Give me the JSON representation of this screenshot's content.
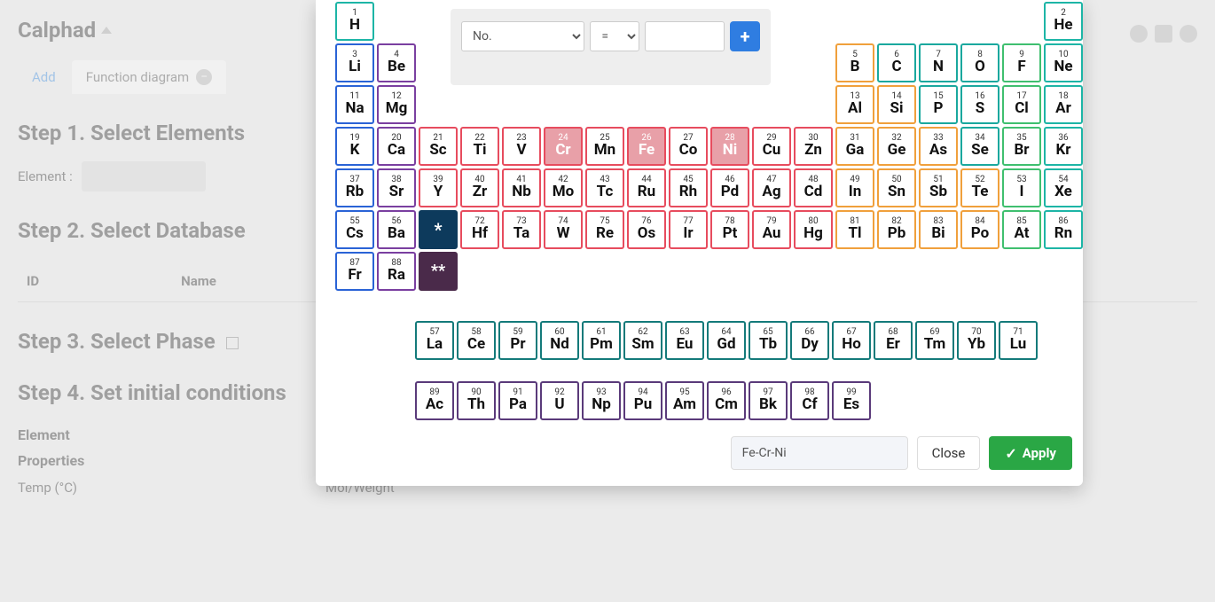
{
  "page": {
    "title": "Calphad",
    "tabs": {
      "add": "Add",
      "func": "Function diagram"
    },
    "step1": "Step 1. Select Elements",
    "element_label": "Element :",
    "step2": "Step 2. Select Database",
    "tbl_id": "ID",
    "tbl_name": "Name",
    "step3": "Step 3. Select Phase",
    "step4": "Step 4. Set initial conditions",
    "element_h": "Element",
    "properties_h": "Properties",
    "temp": "Temp (°C)",
    "molw": "Mol/Weight"
  },
  "filter": {
    "prop": "No.",
    "op": "=",
    "plus": "+"
  },
  "footer": {
    "value": "Fe-Cr-Ni",
    "close": "Close",
    "apply": "Apply"
  },
  "selected": [
    "Cr",
    "Fe",
    "Ni"
  ],
  "elements": [
    {
      "n": 1,
      "s": "H",
      "r": 0,
      "c": 0,
      "k": "c-teal"
    },
    {
      "n": 2,
      "s": "He",
      "r": 0,
      "c": 17,
      "k": "c-teal"
    },
    {
      "n": 3,
      "s": "Li",
      "r": 1,
      "c": 0,
      "k": "c-blue"
    },
    {
      "n": 4,
      "s": "Be",
      "r": 1,
      "c": 1,
      "k": "c-purple"
    },
    {
      "n": 5,
      "s": "B",
      "r": 1,
      "c": 12,
      "k": "c-orange"
    },
    {
      "n": 6,
      "s": "C",
      "r": 1,
      "c": 13,
      "k": "c-teal2"
    },
    {
      "n": 7,
      "s": "N",
      "r": 1,
      "c": 14,
      "k": "c-teal2"
    },
    {
      "n": 8,
      "s": "O",
      "r": 1,
      "c": 15,
      "k": "c-teal2"
    },
    {
      "n": 9,
      "s": "F",
      "r": 1,
      "c": 16,
      "k": "c-green"
    },
    {
      "n": 10,
      "s": "Ne",
      "r": 1,
      "c": 17,
      "k": "c-teal"
    },
    {
      "n": 11,
      "s": "Na",
      "r": 2,
      "c": 0,
      "k": "c-blue"
    },
    {
      "n": 12,
      "s": "Mg",
      "r": 2,
      "c": 1,
      "k": "c-purple"
    },
    {
      "n": 13,
      "s": "Al",
      "r": 2,
      "c": 12,
      "k": "c-orange"
    },
    {
      "n": 14,
      "s": "Si",
      "r": 2,
      "c": 13,
      "k": "c-orange"
    },
    {
      "n": 15,
      "s": "P",
      "r": 2,
      "c": 14,
      "k": "c-teal2"
    },
    {
      "n": 16,
      "s": "S",
      "r": 2,
      "c": 15,
      "k": "c-teal2"
    },
    {
      "n": 17,
      "s": "Cl",
      "r": 2,
      "c": 16,
      "k": "c-green"
    },
    {
      "n": 18,
      "s": "Ar",
      "r": 2,
      "c": 17,
      "k": "c-teal"
    },
    {
      "n": 19,
      "s": "K",
      "r": 3,
      "c": 0,
      "k": "c-blue"
    },
    {
      "n": 20,
      "s": "Ca",
      "r": 3,
      "c": 1,
      "k": "c-purple"
    },
    {
      "n": 21,
      "s": "Sc",
      "r": 3,
      "c": 2,
      "k": "c-red"
    },
    {
      "n": 22,
      "s": "Ti",
      "r": 3,
      "c": 3,
      "k": "c-red"
    },
    {
      "n": 23,
      "s": "V",
      "r": 3,
      "c": 4,
      "k": "c-red"
    },
    {
      "n": 24,
      "s": "Cr",
      "r": 3,
      "c": 5,
      "k": "c-red"
    },
    {
      "n": 25,
      "s": "Mn",
      "r": 3,
      "c": 6,
      "k": "c-red"
    },
    {
      "n": 26,
      "s": "Fe",
      "r": 3,
      "c": 7,
      "k": "c-red"
    },
    {
      "n": 27,
      "s": "Co",
      "r": 3,
      "c": 8,
      "k": "c-red"
    },
    {
      "n": 28,
      "s": "Ni",
      "r": 3,
      "c": 9,
      "k": "c-red"
    },
    {
      "n": 29,
      "s": "Cu",
      "r": 3,
      "c": 10,
      "k": "c-red"
    },
    {
      "n": 30,
      "s": "Zn",
      "r": 3,
      "c": 11,
      "k": "c-red"
    },
    {
      "n": 31,
      "s": "Ga",
      "r": 3,
      "c": 12,
      "k": "c-orange"
    },
    {
      "n": 32,
      "s": "Ge",
      "r": 3,
      "c": 13,
      "k": "c-orange"
    },
    {
      "n": 33,
      "s": "As",
      "r": 3,
      "c": 14,
      "k": "c-orange"
    },
    {
      "n": 34,
      "s": "Se",
      "r": 3,
      "c": 15,
      "k": "c-teal2"
    },
    {
      "n": 35,
      "s": "Br",
      "r": 3,
      "c": 16,
      "k": "c-green"
    },
    {
      "n": 36,
      "s": "Kr",
      "r": 3,
      "c": 17,
      "k": "c-teal"
    },
    {
      "n": 37,
      "s": "Rb",
      "r": 4,
      "c": 0,
      "k": "c-blue"
    },
    {
      "n": 38,
      "s": "Sr",
      "r": 4,
      "c": 1,
      "k": "c-purple"
    },
    {
      "n": 39,
      "s": "Y",
      "r": 4,
      "c": 2,
      "k": "c-red"
    },
    {
      "n": 40,
      "s": "Zr",
      "r": 4,
      "c": 3,
      "k": "c-red"
    },
    {
      "n": 41,
      "s": "Nb",
      "r": 4,
      "c": 4,
      "k": "c-red"
    },
    {
      "n": 42,
      "s": "Mo",
      "r": 4,
      "c": 5,
      "k": "c-red"
    },
    {
      "n": 43,
      "s": "Tc",
      "r": 4,
      "c": 6,
      "k": "c-red"
    },
    {
      "n": 44,
      "s": "Ru",
      "r": 4,
      "c": 7,
      "k": "c-red"
    },
    {
      "n": 45,
      "s": "Rh",
      "r": 4,
      "c": 8,
      "k": "c-red"
    },
    {
      "n": 46,
      "s": "Pd",
      "r": 4,
      "c": 9,
      "k": "c-red"
    },
    {
      "n": 47,
      "s": "Ag",
      "r": 4,
      "c": 10,
      "k": "c-red"
    },
    {
      "n": 48,
      "s": "Cd",
      "r": 4,
      "c": 11,
      "k": "c-red"
    },
    {
      "n": 49,
      "s": "In",
      "r": 4,
      "c": 12,
      "k": "c-orange"
    },
    {
      "n": 50,
      "s": "Sn",
      "r": 4,
      "c": 13,
      "k": "c-orange"
    },
    {
      "n": 51,
      "s": "Sb",
      "r": 4,
      "c": 14,
      "k": "c-orange"
    },
    {
      "n": 52,
      "s": "Te",
      "r": 4,
      "c": 15,
      "k": "c-orange"
    },
    {
      "n": 53,
      "s": "I",
      "r": 4,
      "c": 16,
      "k": "c-green"
    },
    {
      "n": 54,
      "s": "Xe",
      "r": 4,
      "c": 17,
      "k": "c-teal"
    },
    {
      "n": 55,
      "s": "Cs",
      "r": 5,
      "c": 0,
      "k": "c-blue"
    },
    {
      "n": 56,
      "s": "Ba",
      "r": 5,
      "c": 1,
      "k": "c-purple"
    },
    {
      "n": 72,
      "s": "Hf",
      "r": 5,
      "c": 3,
      "k": "c-red"
    },
    {
      "n": 73,
      "s": "Ta",
      "r": 5,
      "c": 4,
      "k": "c-red"
    },
    {
      "n": 74,
      "s": "W",
      "r": 5,
      "c": 5,
      "k": "c-red"
    },
    {
      "n": 75,
      "s": "Re",
      "r": 5,
      "c": 6,
      "k": "c-red"
    },
    {
      "n": 76,
      "s": "Os",
      "r": 5,
      "c": 7,
      "k": "c-red"
    },
    {
      "n": 77,
      "s": "Ir",
      "r": 5,
      "c": 8,
      "k": "c-red"
    },
    {
      "n": 78,
      "s": "Pt",
      "r": 5,
      "c": 9,
      "k": "c-red"
    },
    {
      "n": 79,
      "s": "Au",
      "r": 5,
      "c": 10,
      "k": "c-red"
    },
    {
      "n": 80,
      "s": "Hg",
      "r": 5,
      "c": 11,
      "k": "c-red"
    },
    {
      "n": 81,
      "s": "Tl",
      "r": 5,
      "c": 12,
      "k": "c-orange"
    },
    {
      "n": 82,
      "s": "Pb",
      "r": 5,
      "c": 13,
      "k": "c-orange"
    },
    {
      "n": 83,
      "s": "Bi",
      "r": 5,
      "c": 14,
      "k": "c-orange"
    },
    {
      "n": 84,
      "s": "Po",
      "r": 5,
      "c": 15,
      "k": "c-orange"
    },
    {
      "n": 85,
      "s": "At",
      "r": 5,
      "c": 16,
      "k": "c-green"
    },
    {
      "n": 86,
      "s": "Rn",
      "r": 5,
      "c": 17,
      "k": "c-teal"
    },
    {
      "n": 87,
      "s": "Fr",
      "r": 6,
      "c": 0,
      "k": "c-blue"
    },
    {
      "n": 88,
      "s": "Ra",
      "r": 6,
      "c": 1,
      "k": "c-purple"
    }
  ],
  "lanthanides": [
    {
      "n": 57,
      "s": "La"
    },
    {
      "n": 58,
      "s": "Ce"
    },
    {
      "n": 59,
      "s": "Pr"
    },
    {
      "n": 60,
      "s": "Nd"
    },
    {
      "n": 61,
      "s": "Pm"
    },
    {
      "n": 62,
      "s": "Sm"
    },
    {
      "n": 63,
      "s": "Eu"
    },
    {
      "n": 64,
      "s": "Gd"
    },
    {
      "n": 65,
      "s": "Tb"
    },
    {
      "n": 66,
      "s": "Dy"
    },
    {
      "n": 67,
      "s": "Ho"
    },
    {
      "n": 68,
      "s": "Er"
    },
    {
      "n": 69,
      "s": "Tm"
    },
    {
      "n": 70,
      "s": "Yb"
    },
    {
      "n": 71,
      "s": "Lu"
    }
  ],
  "actinides": [
    {
      "n": 89,
      "s": "Ac"
    },
    {
      "n": 90,
      "s": "Th"
    },
    {
      "n": 91,
      "s": "Pa"
    },
    {
      "n": 92,
      "s": "U"
    },
    {
      "n": 93,
      "s": "Np"
    },
    {
      "n": 94,
      "s": "Pu"
    },
    {
      "n": 95,
      "s": "Am"
    },
    {
      "n": 96,
      "s": "Cm"
    },
    {
      "n": 97,
      "s": "Bk"
    },
    {
      "n": 98,
      "s": "Cf"
    },
    {
      "n": 99,
      "s": "Es"
    }
  ],
  "star": "*",
  "dstar": "**"
}
